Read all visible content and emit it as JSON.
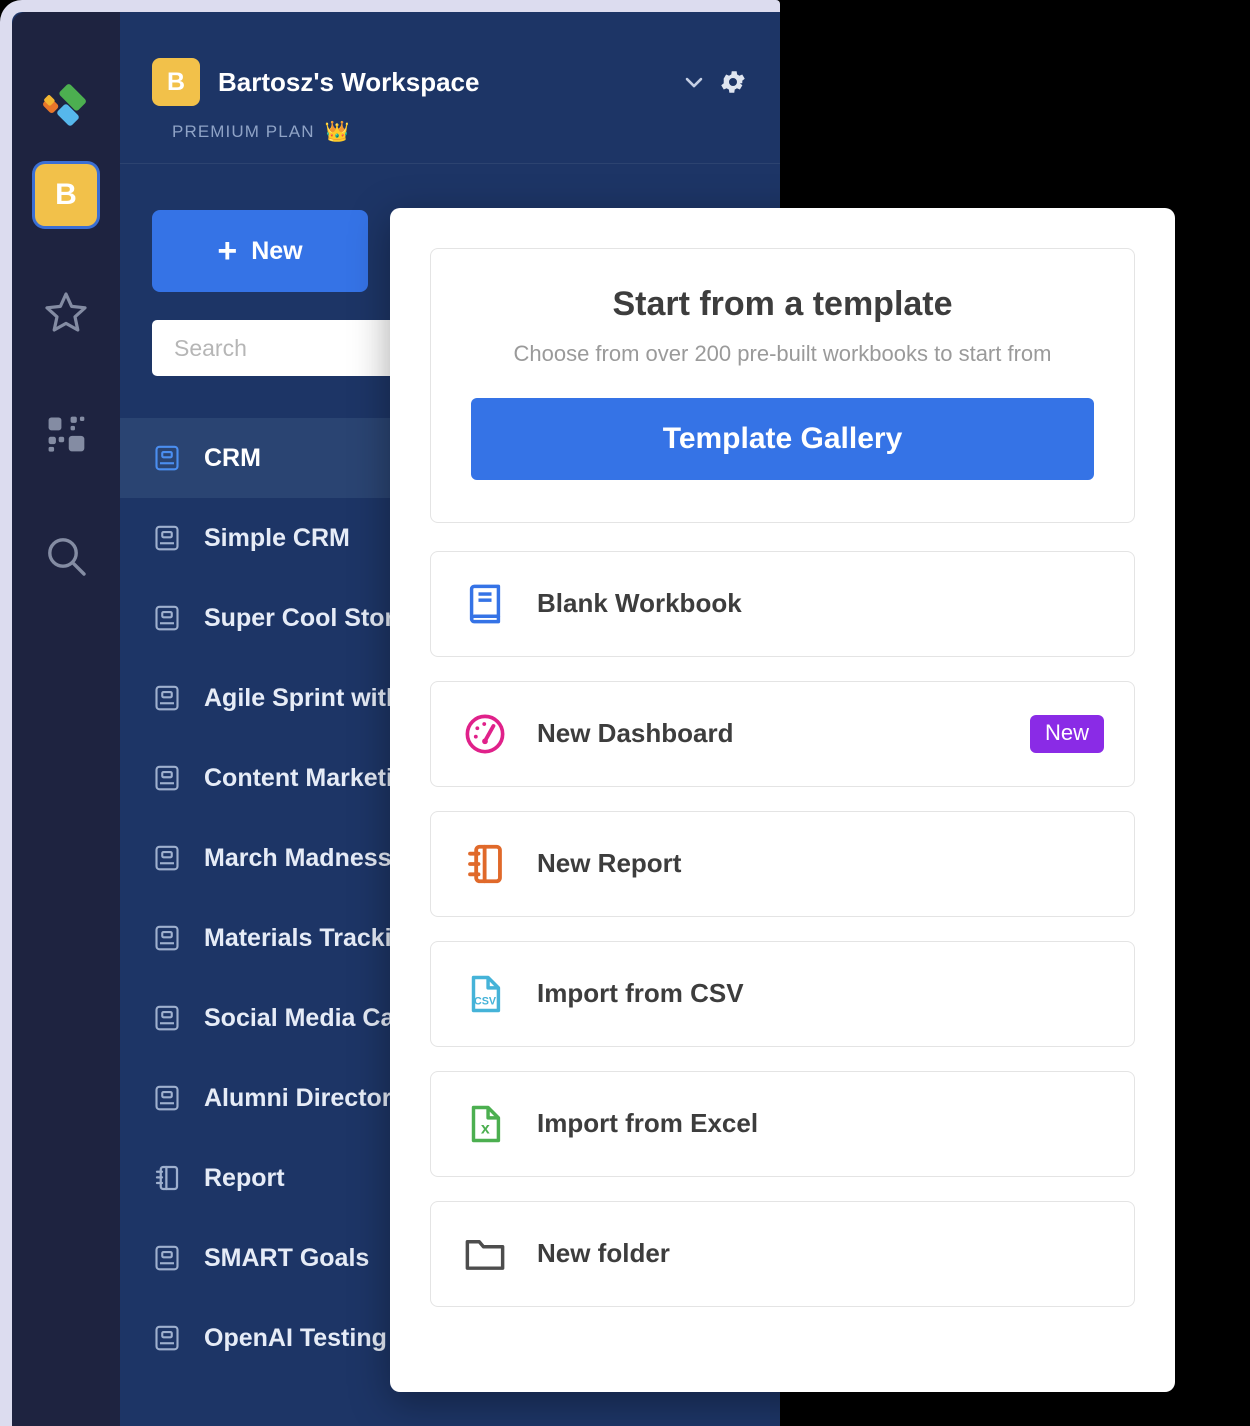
{
  "app": {
    "rail": {
      "logo_icon": "brand-logo-icon",
      "avatar_initial": "B",
      "items": [
        {
          "icon": "star-icon",
          "name": "favorites"
        },
        {
          "icon": "apps-grid-icon",
          "name": "apps"
        },
        {
          "icon": "search-icon",
          "name": "search"
        }
      ]
    },
    "workspace": {
      "badge_initial": "B",
      "name": "Bartosz's Workspace",
      "chevron_icon": "chevron-down-icon",
      "gear_icon": "gear-icon",
      "plan_label": "PREMIUM PLAN",
      "plan_icon": "crown-icon"
    },
    "new_button": {
      "plus": "+",
      "label": "New"
    },
    "search": {
      "value": "",
      "placeholder": "Search"
    },
    "list": [
      {
        "label": "CRM",
        "icon": "workbook-icon",
        "active": true
      },
      {
        "label": "Simple CRM",
        "icon": "workbook-icon",
        "active": false
      },
      {
        "label": "Super Cool Stor",
        "icon": "workbook-icon",
        "active": false
      },
      {
        "label": "Agile Sprint with",
        "icon": "workbook-icon",
        "active": false
      },
      {
        "label": "Content Marketi",
        "icon": "workbook-icon",
        "active": false
      },
      {
        "label": "March Madness",
        "icon": "workbook-icon",
        "active": false
      },
      {
        "label": "Materials Tracki",
        "icon": "workbook-icon",
        "active": false
      },
      {
        "label": "Social Media Ca",
        "icon": "workbook-icon",
        "active": false
      },
      {
        "label": "Alumni Director",
        "icon": "workbook-icon",
        "active": false
      },
      {
        "label": "Report",
        "icon": "report-icon",
        "active": false
      },
      {
        "label": "SMART Goals",
        "icon": "workbook-icon",
        "active": false
      },
      {
        "label": "OpenAI Testing",
        "icon": "workbook-icon",
        "active": false
      }
    ]
  },
  "menu": {
    "template": {
      "title": "Start from a template",
      "subtitle": "Choose from over 200 pre-built workbooks to start from",
      "button_label": "Template Gallery"
    },
    "rows": [
      {
        "label": "Blank Workbook",
        "icon": "blank-workbook-icon",
        "badge": ""
      },
      {
        "label": "New Dashboard",
        "icon": "dashboard-gauge-icon",
        "badge": "New"
      },
      {
        "label": "New Report",
        "icon": "report-notebook-icon",
        "badge": ""
      },
      {
        "label": "Import from CSV",
        "icon": "csv-file-icon",
        "badge": ""
      },
      {
        "label": "Import from Excel",
        "icon": "excel-file-icon",
        "badge": ""
      },
      {
        "label": "New folder",
        "icon": "folder-icon",
        "badge": ""
      }
    ]
  },
  "colors": {
    "accent_blue": "#3573e6",
    "rail_bg": "#1e2340",
    "panel_bg": "#1d3566",
    "active_row": "#2a4472",
    "badge_purple": "#8a2be6",
    "avatar_yellow": "#f2c14a",
    "dashboard_pink": "#e0218a",
    "report_orange": "#e0692a",
    "csv_blue": "#45b3d8",
    "excel_green": "#4caf50"
  }
}
